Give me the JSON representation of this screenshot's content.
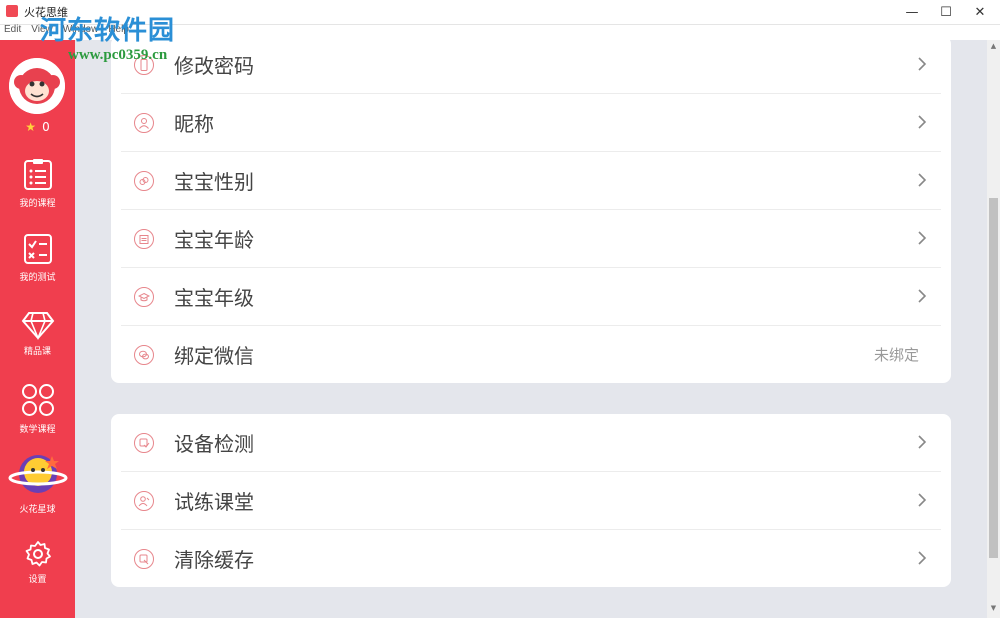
{
  "window": {
    "title": "火花思维",
    "minimize": "—",
    "maximize": "☐",
    "close": "✕"
  },
  "menu": [
    "Edit",
    "View",
    "Window",
    "Help"
  ],
  "watermark": {
    "title": "河东软件园",
    "url": "www.pc0359.cn"
  },
  "profile": {
    "stars": "0"
  },
  "sidebar": {
    "items": [
      {
        "label": "我的课程",
        "icon": "course-list-icon"
      },
      {
        "label": "我的测试",
        "icon": "test-checklist-icon"
      },
      {
        "label": "精品课",
        "icon": "diamond-icon"
      },
      {
        "label": "数学课程",
        "icon": "grid-flower-icon"
      },
      {
        "label": "火花星球",
        "icon": "planet-icon"
      },
      {
        "label": "设置",
        "icon": "gear-icon"
      }
    ]
  },
  "settings": {
    "group1": [
      {
        "label": "修改密码",
        "icon": "phone-icon"
      },
      {
        "label": "昵称",
        "icon": "person-icon"
      },
      {
        "label": "宝宝性别",
        "icon": "gender-icon"
      },
      {
        "label": "宝宝年龄",
        "icon": "calendar-icon"
      },
      {
        "label": "宝宝年级",
        "icon": "graduation-cap-icon"
      },
      {
        "label": "绑定微信",
        "icon": "wechat-icon",
        "value": "未绑定"
      }
    ],
    "group2": [
      {
        "label": "设备检测",
        "icon": "device-check-icon"
      },
      {
        "label": "试练课堂",
        "icon": "practice-icon"
      },
      {
        "label": "清除缓存",
        "icon": "clear-cache-icon"
      }
    ]
  },
  "colors": {
    "sidebar": "#f03e4e",
    "accent_icon": "#e7868c",
    "background": "#e4e6ec"
  }
}
